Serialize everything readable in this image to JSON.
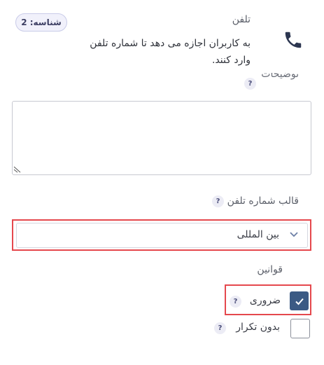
{
  "field": {
    "id_badge": "شناسه: 2",
    "title": "تلفن",
    "description": "به کاربران اجازه می دهد تا شماره تلفن وارد کنند.",
    "icon": "phone-icon"
  },
  "descriptions": {
    "label": "توضیحات",
    "help": "?",
    "value": ""
  },
  "phone_format": {
    "label": "قالب شماره تلفن",
    "help": "?",
    "selected": "بین المللی"
  },
  "rules": {
    "label": "قوانین",
    "required": {
      "label": "ضروری",
      "checked": true,
      "help": "?"
    },
    "no_duplicate": {
      "label": "بدون تکرار",
      "checked": false,
      "help": "?"
    }
  },
  "colors": {
    "checkbox_checked": "#3b5a84",
    "highlight": "#e5484d",
    "badge_bg": "#f1f1fb"
  }
}
